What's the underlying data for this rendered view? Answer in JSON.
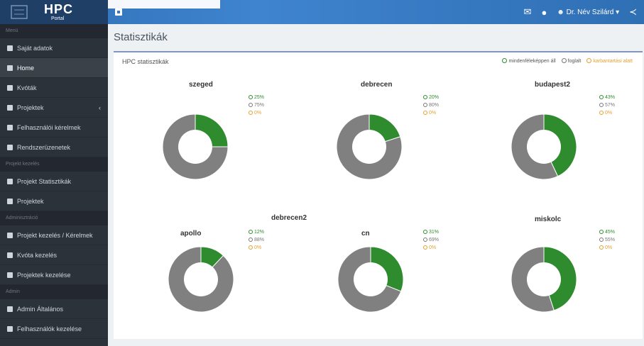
{
  "app": {
    "logo_title": "HPC",
    "logo_sub": "Portal"
  },
  "header": {
    "user_label": "Dr. Név Szilárd ▾"
  },
  "sidebar": {
    "sections": [
      "Menü",
      "Projekt kezelés",
      "Adminisztráció",
      "Admin"
    ],
    "items": [
      {
        "label": "Saját adatok",
        "icon": "user-icon"
      },
      {
        "label": "Home",
        "icon": "home-icon",
        "active": true
      },
      {
        "label": "Kvóták",
        "icon": "table-icon"
      },
      {
        "label": "Projektek",
        "icon": "folder-icon",
        "arrow": "‹"
      },
      {
        "label": "Felhasználói kérelmek",
        "icon": "list-icon"
      },
      {
        "label": "Rendszerüzenetek",
        "icon": "bell-icon"
      },
      {
        "label": "Projekt Statisztikák",
        "icon": "chart-icon"
      },
      {
        "label": "Projektek",
        "icon": "folder-icon"
      },
      {
        "label": "Projekt kezelés / Kérelmek",
        "icon": "list-icon"
      },
      {
        "label": "Kvóta kezelés",
        "icon": "table-icon"
      },
      {
        "label": "Projektek kezelése",
        "icon": "table-icon"
      },
      {
        "label": "Admin Általános",
        "icon": "list-icon"
      },
      {
        "label": "Felhasználók kezelése",
        "icon": "users-icon"
      }
    ]
  },
  "page": {
    "title": "Statisztikák"
  },
  "panel": {
    "title": "HPC statisztikák",
    "legend": [
      {
        "label": "mindenféleképpen áll",
        "color": "#2e8b2e"
      },
      {
        "label": "foglalt",
        "color": "#777777"
      },
      {
        "label": "karbantartási alatt",
        "color": "#e3a033"
      }
    ]
  },
  "group_title": "debrecen2",
  "chart_data": [
    {
      "type": "pie",
      "title": "szeged",
      "values": [
        25,
        75,
        0
      ],
      "labels": [
        "25%",
        "75%",
        "0%"
      ]
    },
    {
      "type": "pie",
      "title": "debrecen",
      "values": [
        20,
        80,
        0
      ],
      "labels": [
        "20%",
        "80%",
        "0%"
      ]
    },
    {
      "type": "pie",
      "title": "budapest2",
      "values": [
        43,
        57,
        0
      ],
      "labels": [
        "43%",
        "57%",
        "0%"
      ]
    },
    {
      "type": "pie",
      "title": "apollo",
      "values": [
        12,
        88,
        0
      ],
      "labels": [
        "12%",
        "88%",
        "0%"
      ]
    },
    {
      "type": "pie",
      "title": "cn",
      "values": [
        31,
        69,
        0
      ],
      "labels": [
        "31%",
        "69%",
        "0%"
      ]
    },
    {
      "type": "pie",
      "title": "miskolc",
      "values": [
        45,
        55,
        0
      ],
      "labels": [
        "45%",
        "55%",
        "0%"
      ]
    }
  ],
  "colors": {
    "free": "#2e8b2e",
    "busy": "#808080",
    "maint": "#e3a033"
  }
}
